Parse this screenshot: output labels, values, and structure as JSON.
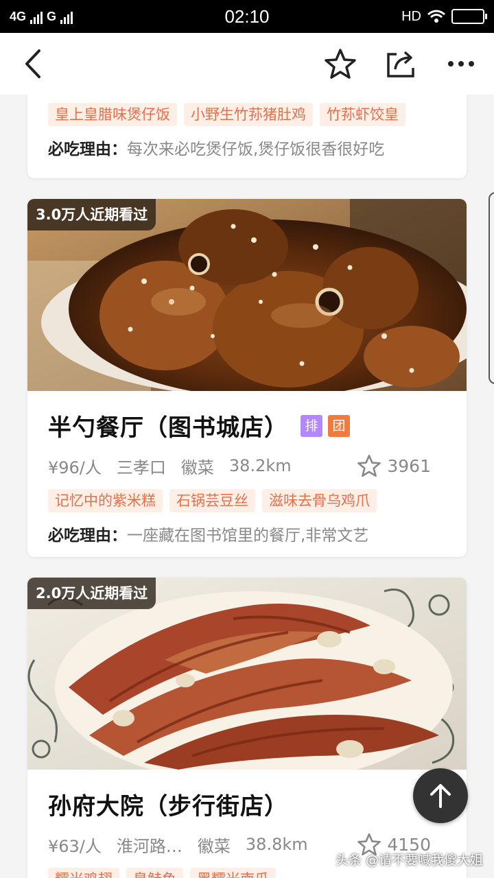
{
  "status_bar": {
    "network_left": "4G",
    "network_right": "G",
    "time": "02:10",
    "hd": "HD"
  },
  "toolbar": {
    "back_icon": "back-arrow-icon",
    "star_icon": "star-icon",
    "share_icon": "share-icon",
    "more_icon": "more-icon"
  },
  "cards": [
    {
      "tags": [
        "皇上皇腊味煲仔饭",
        "小野生竹荪猪肚鸡",
        "竹荪虾饺皇"
      ],
      "reason_label": "必吃理由：",
      "reason": "每次来必吃煲仔饭,煲仔饭很香很好吃"
    },
    {
      "seen": "3.0万人近期看过",
      "title": "半勺餐厅（图书城店）",
      "badges": [
        "排",
        "团"
      ],
      "price": "¥96/人",
      "area": "三孝口",
      "cuisine": "徽菜",
      "distance": "38.2km",
      "favorites": "3961",
      "tags": [
        "记忆中的紫米糕",
        "石锅芸豆丝",
        "滋味去骨乌鸡爪"
      ],
      "reason_label": "必吃理由：",
      "reason": "一座藏在图书馆里的餐厅,非常文艺"
    },
    {
      "seen": "2.0万人近期看过",
      "title": "孙府大院（步行街店）",
      "price": "¥63/人",
      "area": "淮河路…",
      "cuisine": "徽菜",
      "distance": "38.8km",
      "favorites": "4150",
      "tags": [
        "糯米鸡翅",
        "臭鲑鱼",
        "黑糯米南瓜"
      ]
    }
  ],
  "watermark": "头条 @请不要喊我傻大姐",
  "colors": {
    "accent": "#e2704b",
    "badge_pai": "#b388ff",
    "badge_tuan": "#f07b3f"
  }
}
